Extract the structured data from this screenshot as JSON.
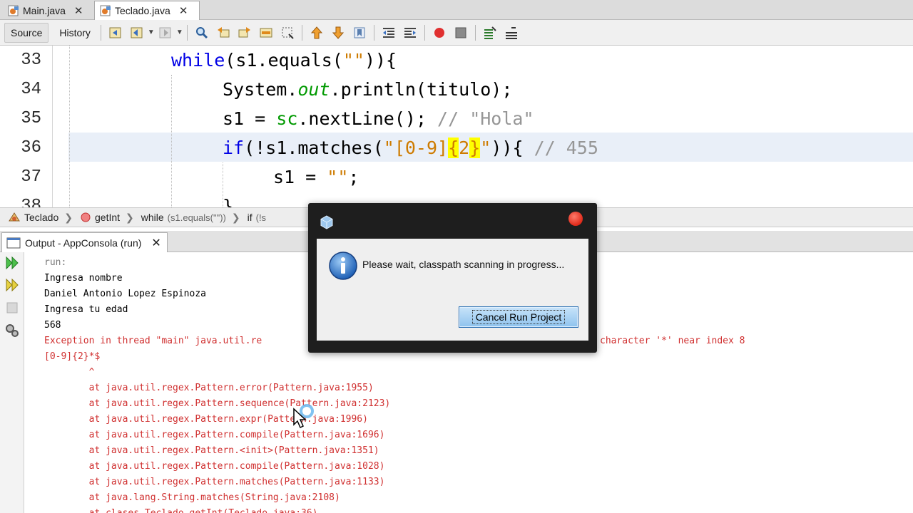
{
  "editor_tabs": [
    {
      "label": "Main.java",
      "active": false
    },
    {
      "label": "Teclado.java",
      "active": true
    }
  ],
  "toolbar": {
    "source_label": "Source",
    "history_label": "History"
  },
  "code_lines": {
    "numbers": [
      "33",
      "34",
      "35",
      "36",
      "37",
      "38"
    ],
    "l33": {
      "kw": "while",
      "rest": "(s1.equals(",
      "str": "\"\"",
      "end": ")){"
    },
    "l34": {
      "pre": "System.",
      "field": "out",
      "post": ".println(titulo);"
    },
    "l35": {
      "pre": "s1 = ",
      "obj": "sc",
      "post": ".nextLine(); ",
      "comment": "// \"Hola\""
    },
    "l36": {
      "kw": "if",
      "pre": "(!s1.matches(",
      "q1": "\"[0-9]",
      "m1": "{",
      "q2": "2",
      "m2": "}",
      "q3": "\"",
      "post": ")){ ",
      "comment": "// 455"
    },
    "l37": {
      "pre": "s1 = ",
      "str": "\"\"",
      "end": ";"
    },
    "l38": {
      "text": "}"
    }
  },
  "breadcrumb": [
    {
      "label": "Teclado",
      "icon": "class-icon"
    },
    {
      "label": "getInt",
      "icon": "method-icon"
    },
    {
      "label": "while",
      "extra": "(s1.equals(\"\"))"
    },
    {
      "label": "if",
      "extra": "(!s"
    }
  ],
  "output": {
    "tab_label": "Output - AppConsola (run)",
    "lines": [
      {
        "text": "run:",
        "style": "gray"
      },
      {
        "text": "Ingresa nombre",
        "style": "black"
      },
      {
        "text": "Daniel Antonio Lopez Espinoza",
        "style": "black"
      },
      {
        "text": "Ingresa tu edad",
        "style": "black"
      },
      {
        "text": "568",
        "style": "black"
      },
      {
        "text": "Exception in thread \"main\" java.util.re",
        "style": "red"
      },
      {
        "text": "[0-9]{2}*$",
        "style": "red"
      },
      {
        "text": "        ^",
        "style": "red"
      },
      {
        "text": "        at java.util.regex.Pattern.error(Pattern.java:1955)",
        "style": "red"
      },
      {
        "text": "        at java.util.regex.Pattern.sequence(Pattern.java:2123)",
        "style": "red"
      },
      {
        "text": "        at java.util.regex.Pattern.expr(Pattern.java:1996)",
        "style": "red"
      },
      {
        "text": "        at java.util.regex.Pattern.compile(Pattern.java:1696)",
        "style": "red"
      },
      {
        "text": "        at java.util.regex.Pattern.<init>(Pattern.java:1351)",
        "style": "red"
      },
      {
        "text": "        at java.util.regex.Pattern.compile(Pattern.java:1028)",
        "style": "red"
      },
      {
        "text": "        at java.util.regex.Pattern.matches(Pattern.java:1133)",
        "style": "red"
      },
      {
        "text": "        at java.lang.String.matches(String.java:2108)",
        "style": "red"
      },
      {
        "text": "        at clases.Teclado.getInt(Teclado.java:36)",
        "style": "red"
      }
    ],
    "exception_tail": "character '*' near index 8"
  },
  "dialog": {
    "message": "Please wait, classpath scanning in progress...",
    "button_label": "Cancel Run Project"
  },
  "colors": {
    "keyword": "#0000e6",
    "string": "#ce7b00",
    "comment": "#969696",
    "error": "#d03030",
    "match_highlight": "#ffff00"
  }
}
